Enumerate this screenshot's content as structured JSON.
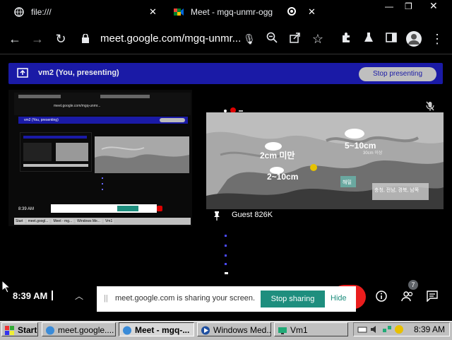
{
  "tabs": [
    {
      "label": "file:///"
    },
    {
      "label": "Meet - mgq-unmr-ogg"
    }
  ],
  "toolbar": {
    "url": "meet.google.com/mgq-unmr..."
  },
  "presenting": {
    "label": "vm2 (You, presenting)",
    "stop_label": "Stop presenting"
  },
  "tile": {
    "guest_name": "Guest 826K"
  },
  "weather_map": {
    "labels": [
      {
        "text": "2cm 미만"
      },
      {
        "text": "5~10cm"
      },
      {
        "text": "2~10cm"
      },
      {
        "text": "30cm 이상"
      },
      {
        "text": "해밀"
      },
      {
        "text": "충청, 전남, 경북, 남쪽"
      }
    ]
  },
  "bottom": {
    "time": "8:39 AM",
    "notification_count": "7"
  },
  "share_bar": {
    "text": "meet.google.com is sharing your screen.",
    "stop_label": "Stop sharing",
    "hide_label": "Hide"
  },
  "taskbar": {
    "start_label": "Start",
    "items": [
      {
        "label": "meet.google...."
      },
      {
        "label": "Meet - mgq-..."
      },
      {
        "label": "Windows Med..."
      },
      {
        "label": "Vm1"
      }
    ],
    "clock": "8:39 AM"
  },
  "nested": {
    "pres_label": "vm2 (You, presenting)",
    "url": "meet.google.com/mgq-unmr...",
    "time": "8:39 AM",
    "taskbar_items": [
      {
        "label": "Start"
      },
      {
        "label": "meet.googl..."
      },
      {
        "label": "Meet - mg..."
      },
      {
        "label": "Windows Me..."
      },
      {
        "label": "Vm1"
      }
    ]
  }
}
